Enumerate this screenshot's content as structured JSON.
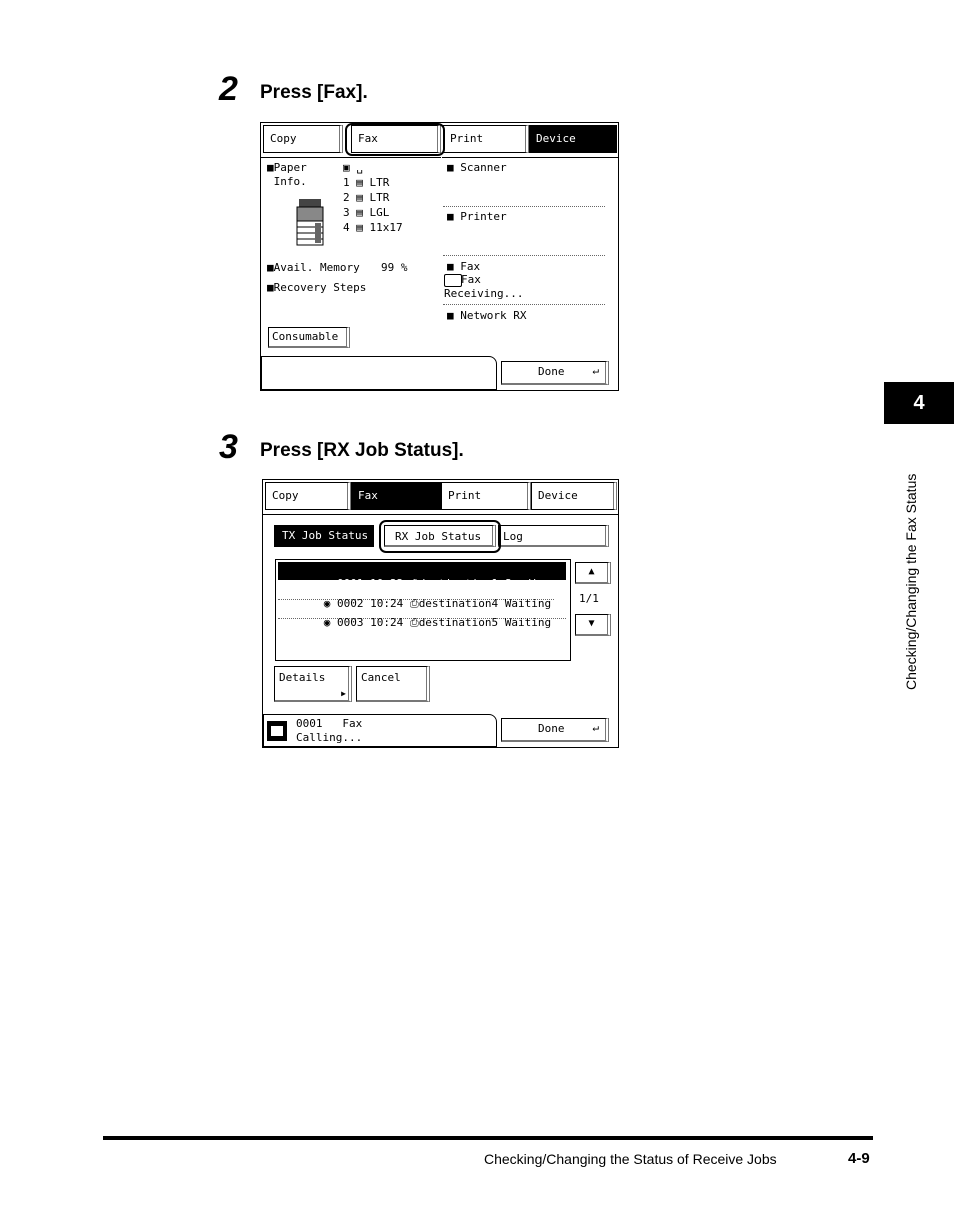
{
  "steps": [
    {
      "number": "2",
      "text": "Press [Fax]."
    },
    {
      "number": "3",
      "text": "Press [RX Job Status]."
    }
  ],
  "screen1": {
    "tabs": [
      "Copy",
      "Fax",
      "Print",
      "Device"
    ],
    "paper_label": "■Paper\n Info.",
    "paper_rows": [
      "▣ ␣",
      "1 ▤ LTR",
      "2 ▤ LTR",
      "3 ▤ LGL",
      "4 ▤ 11x17"
    ],
    "avail_memory_label": "■Avail. Memory",
    "avail_memory_value": "99 %",
    "recovery_steps": "■Recovery Steps",
    "consumable_button": "Consumable",
    "right_items": {
      "scanner": "■ Scanner",
      "printer": "■ Printer",
      "fax": "■ Fax",
      "fax_status_line1": "Fax",
      "fax_status_line2": "Receiving...",
      "network_rx": "■ Network RX"
    },
    "done_button": "Done"
  },
  "screen2": {
    "tabs": [
      "Copy",
      "Fax",
      "Print",
      "Device"
    ],
    "subtabs": [
      "TX Job Status",
      "RX Job Status",
      "Log"
    ],
    "jobs": [
      {
        "marker": "▶",
        "id": "0001",
        "time": "10:22",
        "dest": "destination1",
        "status": "Sending..."
      },
      {
        "marker": "◉",
        "id": "0002",
        "time": "10:24",
        "dest": "destination4",
        "status": "Waiting"
      },
      {
        "marker": "◉",
        "id": "0003",
        "time": "10:24",
        "dest": "destination5",
        "status": "Waiting"
      }
    ],
    "page_indicator": "1/1",
    "details_button": "Details",
    "cancel_button": "Cancel",
    "status_line1": "0001   Fax",
    "status_line2": "Calling...",
    "done_button": "Done"
  },
  "sidebar": {
    "chapter": "4",
    "title": "Checking/Changing the Fax Status"
  },
  "footer": {
    "title": "Checking/Changing the Status of Receive Jobs",
    "page": "4-9"
  }
}
